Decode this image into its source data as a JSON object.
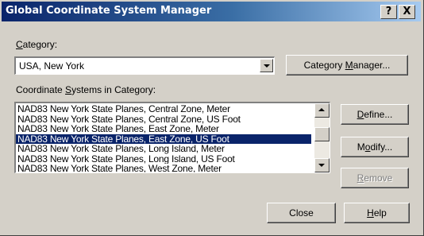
{
  "window": {
    "title": "Global Coordinate System Manager",
    "help_button": "?",
    "close_button": "X"
  },
  "category": {
    "label_mnemonic": "C",
    "label_rest": "ategory:",
    "selected_value": "USA, New York",
    "manager_button_pre": "Category ",
    "manager_button_mnemonic": "M",
    "manager_button_post": "anager..."
  },
  "systems": {
    "label_pre": "Coordinate ",
    "label_mnemonic": "S",
    "label_post": "ystems in Category:",
    "items": [
      "NAD83 New York State Planes, Central Zone, Meter",
      "NAD83 New York State Planes, Central Zone, US Foot",
      "NAD83 New York State Planes, East Zone, Meter",
      "NAD83 New York State Planes, East Zone, US Foot",
      "NAD83 New York State Planes, Long Island, Meter",
      "NAD83 New York State Planes, Long Island, US Foot",
      "NAD83 New York State Planes, West Zone, Meter"
    ],
    "selected_index": 3
  },
  "buttons": {
    "define_mnemonic": "D",
    "define_rest": "efine...",
    "modify_pre": "M",
    "modify_mnemonic": "o",
    "modify_post": "dify...",
    "remove_mnemonic": "R",
    "remove_rest": "emove",
    "close": "Close",
    "help_mnemonic": "H",
    "help_rest": "elp"
  },
  "colors": {
    "selection": "#0a246a",
    "face": "#d4d0c8"
  }
}
